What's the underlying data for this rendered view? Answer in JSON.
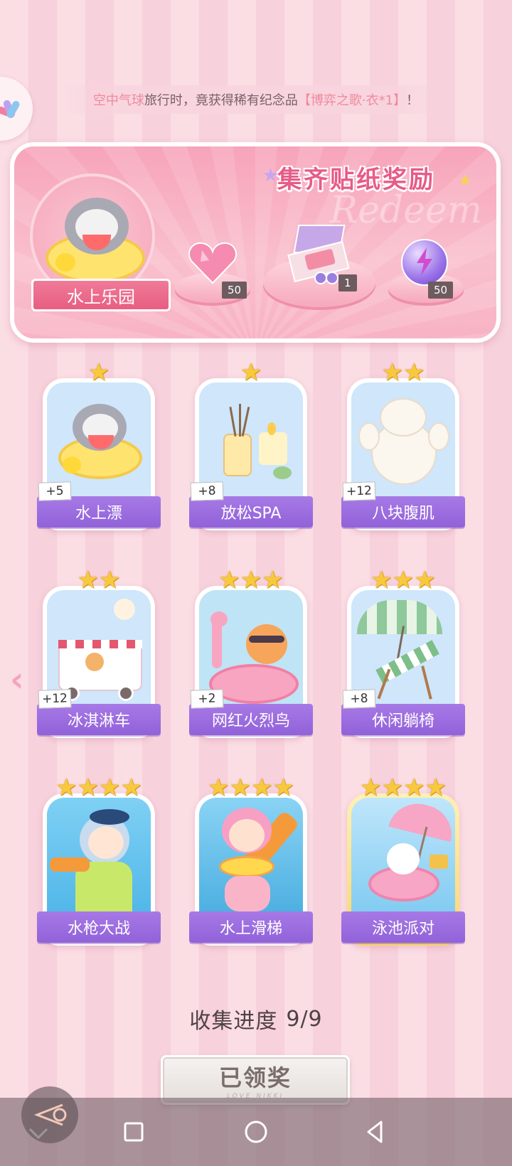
{
  "marquee": {
    "prefix": "空中气球",
    "middle": "旅行时，竟获得稀有纪念品",
    "item": "【博弈之歌·衣*1】",
    "suffix": "！"
  },
  "reward_panel": {
    "title": "集齐贴纸奖励",
    "watermark": "Redeem",
    "theme_label": "水上乐园",
    "rewards": [
      {
        "name": "pink-heart-gem",
        "count": "50"
      },
      {
        "name": "gift-box",
        "count": "1"
      },
      {
        "name": "purple-energy-orb",
        "count": "50"
      }
    ]
  },
  "stickers": [
    {
      "name": "水上漂",
      "stars": 1,
      "plus": "+5"
    },
    {
      "name": "放松SPA",
      "stars": 1,
      "plus": "+8"
    },
    {
      "name": "八块腹肌",
      "stars": 2,
      "plus": "+12"
    },
    {
      "name": "冰淇淋车",
      "stars": 2,
      "plus": "+12"
    },
    {
      "name": "网红火烈鸟",
      "stars": 3,
      "plus": "+2"
    },
    {
      "name": "休闲躺椅",
      "stars": 3,
      "plus": "+8"
    },
    {
      "name": "水枪大战",
      "stars": 4,
      "plus": ""
    },
    {
      "name": "水上滑梯",
      "stars": 4,
      "plus": ""
    },
    {
      "name": "泳池派对",
      "stars": 4,
      "plus": ""
    }
  ],
  "progress": {
    "label": "收集进度",
    "value": "9/9"
  },
  "claim_button": {
    "label": "已领奖",
    "sub": "LOVE NIKKI"
  },
  "colors": {
    "accent": "#e75b87",
    "card_label": "#9162d9",
    "star": "#f8c93c"
  }
}
